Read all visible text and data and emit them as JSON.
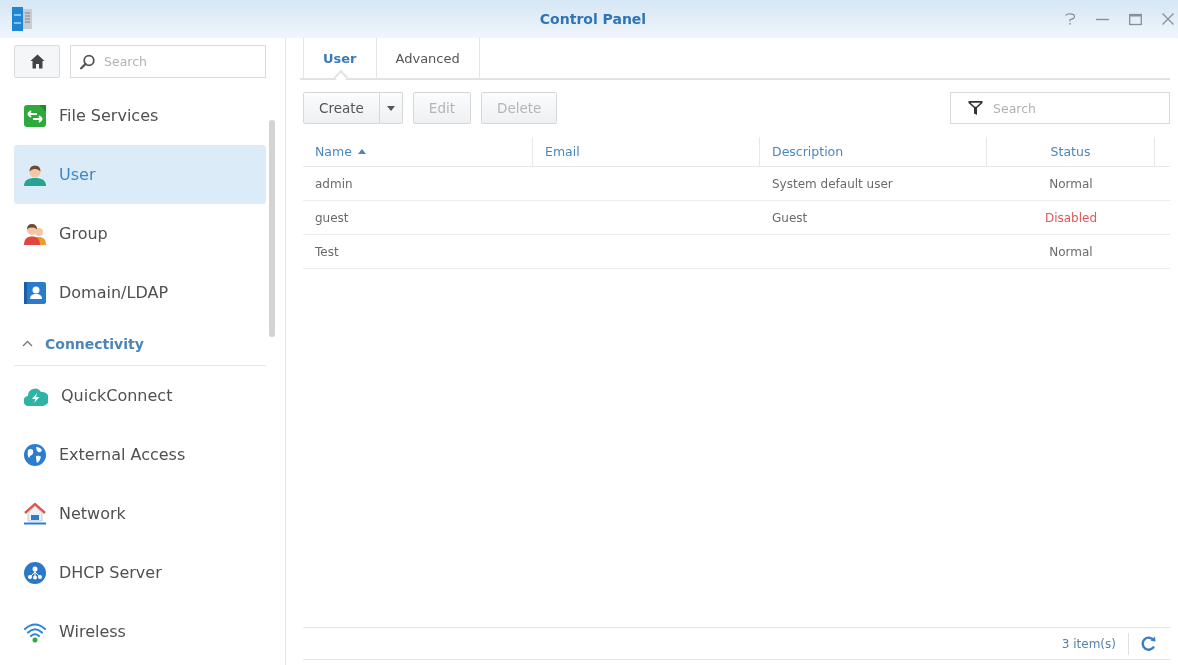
{
  "window": {
    "title": "Control Panel"
  },
  "sidebar": {
    "search": {
      "placeholder": "Search"
    },
    "items": [
      {
        "label": "File Services",
        "selected": false
      },
      {
        "label": "User",
        "selected": true
      },
      {
        "label": "Group",
        "selected": false
      },
      {
        "label": "Domain/LDAP",
        "selected": false
      }
    ],
    "sections": [
      {
        "label": "Connectivity",
        "expanded": true,
        "items": [
          {
            "label": "QuickConnect",
            "selected": false
          },
          {
            "label": "External Access",
            "selected": false
          },
          {
            "label": "Network",
            "selected": false
          },
          {
            "label": "DHCP Server",
            "selected": false
          },
          {
            "label": "Wireless",
            "selected": false
          }
        ]
      }
    ]
  },
  "tabs": [
    {
      "label": "User",
      "selected": true
    },
    {
      "label": "Advanced",
      "selected": false
    }
  ],
  "toolbar": {
    "buttons": [
      {
        "label": "Create",
        "kind": "split",
        "disabled": false
      },
      {
        "label": "Edit",
        "kind": "plain",
        "disabled": true
      },
      {
        "label": "Delete",
        "kind": "plain",
        "disabled": true
      }
    ],
    "search": {
      "placeholder": "Search"
    }
  },
  "table": {
    "columns": [
      {
        "label": "Name",
        "sorted": true
      },
      {
        "label": "Email",
        "sorted": false
      },
      {
        "label": "Description",
        "sorted": false
      },
      {
        "label": "Status",
        "sorted": false
      }
    ],
    "rows": [
      {
        "name": "admin",
        "description": "System default user",
        "status": {
          "label": "Normal",
          "color": "#6b6b6b"
        }
      },
      {
        "name": "guest",
        "description": "Guest",
        "status": {
          "label": "Disabled",
          "color": "#e0585a"
        }
      },
      {
        "name": "Test",
        "status": {
          "label": "Normal",
          "color": "#6b6b6b"
        }
      }
    ]
  },
  "status_bar": {
    "count": "3 item(s)"
  }
}
